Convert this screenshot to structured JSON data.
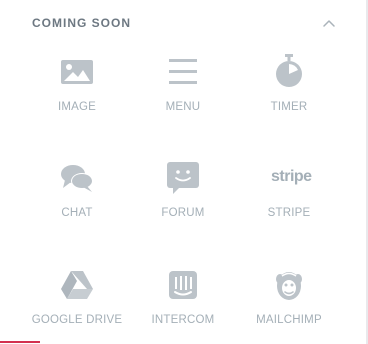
{
  "section": {
    "title": "COMING SOON",
    "toggle_icon": "chevron-up-icon"
  },
  "widgets": [
    {
      "label": "IMAGE",
      "icon": "image-icon"
    },
    {
      "label": "MENU",
      "icon": "menu-icon"
    },
    {
      "label": "TIMER",
      "icon": "stopwatch-icon"
    },
    {
      "label": "CHAT",
      "icon": "chat-bubbles-icon"
    },
    {
      "label": "FORUM",
      "icon": "forum-icon"
    },
    {
      "label": "STRIPE",
      "icon": "stripe-logo-icon",
      "logo_text": "stripe"
    },
    {
      "label": "GOOGLE DRIVE",
      "icon": "google-drive-icon"
    },
    {
      "label": "INTERCOM",
      "icon": "intercom-icon"
    },
    {
      "label": "MAILCHIMP",
      "icon": "mailchimp-icon"
    }
  ],
  "colors": {
    "icon": "#bcc3c9",
    "label": "#a4afb7",
    "title": "#6d7882",
    "accent": "#d3304f"
  }
}
